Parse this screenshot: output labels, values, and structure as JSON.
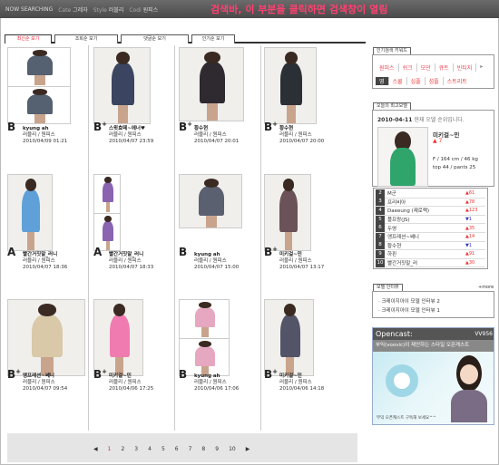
{
  "topbar": {
    "items": [
      {
        "key": "",
        "value": "NOW SEARCHING"
      },
      {
        "key": "Cate",
        "value": "그레자"
      },
      {
        "key": "Style",
        "value": "러블리"
      },
      {
        "key": "Codi",
        "value": "원피스"
      }
    ]
  },
  "annotation": "검색바, 이 부분을 클릭하면 검색창이 열림",
  "tabs": [
    {
      "label": "최신순 보기",
      "active": true
    },
    {
      "label": "조회순 보기",
      "active": false
    },
    {
      "label": "댓글순 보기",
      "active": false
    },
    {
      "label": "인기순 보기",
      "active": false
    }
  ],
  "posts": [
    {
      "grade": "B",
      "plus": false,
      "name": "kyung ah",
      "tags": "러블리 / 원피스",
      "date": "2010/04/09 01:21"
    },
    {
      "grade": "B",
      "plus": true,
      "name": "스윗효떼~에너♥",
      "tags": "러블리 / 원피스",
      "date": "2010/04/07 23:59"
    },
    {
      "grade": "B",
      "plus": true,
      "name": "황수현",
      "tags": "러블리 / 원피스",
      "date": "2010/04/07 20:01"
    },
    {
      "grade": "B",
      "plus": true,
      "name": "황수현",
      "tags": "러블리 / 원피스",
      "date": "2010/04/07 20:00"
    },
    {
      "grade": "A",
      "plus": false,
      "name": "빨간거짓말_러니",
      "tags": "러블리 / 원피스",
      "date": "2010/04/07 18:36"
    },
    {
      "grade": "A",
      "plus": false,
      "name": "빨간거짓말_러니",
      "tags": "러블리 / 원피스",
      "date": "2010/04/07 18:33"
    },
    {
      "grade": "B",
      "plus": false,
      "name": "kyung ah",
      "tags": "러블리 / 원피스",
      "date": "2010/04/07 15:00"
    },
    {
      "grade": "B",
      "plus": true,
      "name": "미키걸~민",
      "tags": "러블리 / 원피스",
      "date": "2010/04/07 13:17"
    },
    {
      "grade": "B",
      "plus": true,
      "name": "앵프레션~쎄니",
      "tags": "러블리 / 원피스",
      "date": "2010/04/07 09:54"
    },
    {
      "grade": "B",
      "plus": true,
      "name": "미키걸~민",
      "tags": "러블리 / 원피스",
      "date": "2010/04/06 17:25"
    },
    {
      "grade": "B",
      "plus": false,
      "name": "kyung ah",
      "tags": "러블리 / 원피스",
      "date": "2010/04/06 17:06"
    },
    {
      "grade": "B",
      "plus": true,
      "name": "미키걸~민",
      "tags": "러블리 / 원피스",
      "date": "2010/04/06 14:18"
    }
  ],
  "pagination": {
    "prev": "◀",
    "next": "▶",
    "pages": [
      "1",
      "2",
      "3",
      "4",
      "5",
      "6",
      "7",
      "8",
      "9",
      "10"
    ],
    "current": "1"
  },
  "keywords": {
    "title": "인기검색 키워드",
    "row1": [
      "원피스",
      "쉬크",
      "모던",
      "큐트",
      "빈티지"
    ],
    "row2": [
      "스쿨",
      "심플",
      "섬플",
      "스트리트"
    ],
    "row1_icon": "chevron-right-icon",
    "row2_tag": "영"
  },
  "best_model": {
    "title": "오늘의 최고모델",
    "date": "2010-04-11",
    "date_note": "현재 오델 순위입니다.",
    "name": "미키걸~민",
    "rank_change": "7",
    "stats1": "F / 164 cm / 46 kg",
    "stats2": "top 44 / pants 25"
  },
  "ranking": [
    {
      "rank": "2",
      "name": "M군",
      "delta": "61",
      "dir": "up"
    },
    {
      "rank": "3",
      "name": "프리비아",
      "delta": "78",
      "dir": "up"
    },
    {
      "rank": "4",
      "name": "Daeeung (제로랙)",
      "delta": "123",
      "dir": "up"
    },
    {
      "rank": "5",
      "name": "플프랑(JS)",
      "delta": "1",
      "dir": "down"
    },
    {
      "rank": "6",
      "name": "두영",
      "delta": "35",
      "dir": "up"
    },
    {
      "rank": "7",
      "name": "앵프레션~쎄니",
      "delta": "14",
      "dir": "up"
    },
    {
      "rank": "8",
      "name": "황수현",
      "delta": "1",
      "dir": "down"
    },
    {
      "rank": "9",
      "name": "하핀",
      "delta": "91",
      "dir": "up"
    },
    {
      "rank": "10",
      "name": "빨간거짓말_러",
      "delta": "30",
      "dir": "up"
    }
  ],
  "interview": {
    "title": "모델 인터뷰",
    "more": "+more",
    "items": [
      "크레이지아이 모델 인터뷰 2",
      "크레이지아이 모델 인터뷰 1"
    ]
  },
  "ad": {
    "brand": "Opencast:",
    "brand_right": "VV956",
    "subtitle": "부익(voovic)이 제안하는 스타일 오픈캐스트",
    "footer": "부익 오픈캐스트 구독해 보세요^^"
  },
  "colors": {
    "accent": "#e23",
    "up": "#e33",
    "down": "#33c",
    "annotation": "#ff4070"
  }
}
